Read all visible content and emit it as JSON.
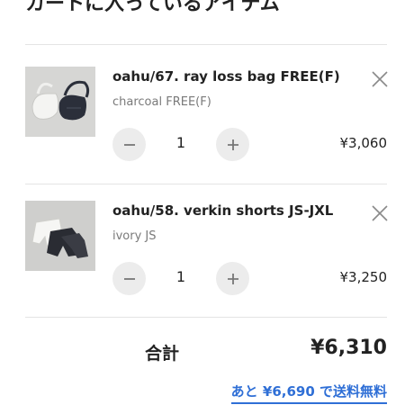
{
  "header": {
    "title": "カートに入っているアイテム"
  },
  "cart": {
    "items": [
      {
        "name": "oahu/67. ray loss bag FREE(F)",
        "variant": "charcoal FREE(F)",
        "quantity": "1",
        "price": "¥3,060",
        "image_icon": "bag-photo"
      },
      {
        "name": "oahu/58. verkin shorts JS-JXL",
        "variant": "ivory JS",
        "quantity": "1",
        "price": "¥3,250",
        "image_icon": "shorts-photo"
      }
    ],
    "controls": {
      "remove_icon": "close-icon",
      "decrease_icon": "minus-icon",
      "increase_icon": "plus-icon"
    }
  },
  "summary": {
    "total_label": "合計",
    "total_value": "¥6,310",
    "free_shipping_text": "あと ¥6,690 で送料無料"
  },
  "colors": {
    "accent": "#2f6fd6",
    "button_bg": "#ececec",
    "muted_text": "#7a7a7a",
    "divider": "#e4e4e4"
  }
}
